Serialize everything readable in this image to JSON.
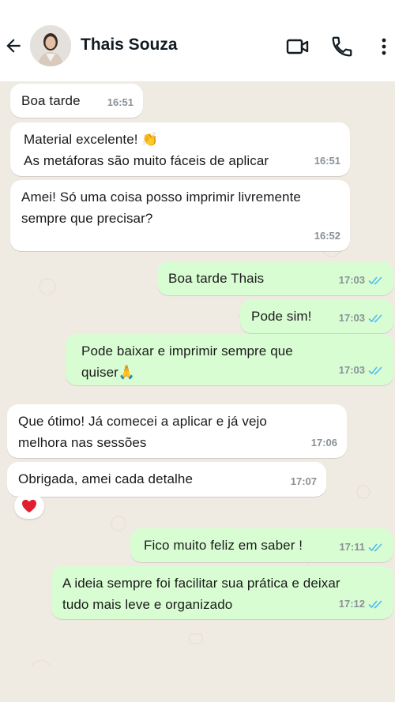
{
  "header": {
    "contact_name": "Thais Souza"
  },
  "messages": [
    {
      "dir": "in",
      "text": "Boa tarde",
      "time": "16:51"
    },
    {
      "dir": "in",
      "text": "Material excelente! 👏\nAs metáforas são muito fáceis de aplicar",
      "time": "16:51"
    },
    {
      "dir": "in",
      "text": "Amei! Só uma coisa posso imprimir livremente\nsempre que precisar?",
      "time": "16:52"
    },
    {
      "dir": "out",
      "text": "Boa tarde Thais",
      "time": "17:03"
    },
    {
      "dir": "out",
      "text": "Pode sim!",
      "time": "17:03"
    },
    {
      "dir": "out",
      "text": "Pode baixar e imprimir sempre que\nquiser🙏",
      "time": "17:03"
    },
    {
      "dir": "in",
      "text": "Que ótimo! Já comecei a aplicar e já vejo\nmelhora nas sessões",
      "time": "17:06"
    },
    {
      "dir": "in",
      "text": "Obrigada, amei cada detalhe",
      "time": "17:07",
      "reaction": "heart"
    },
    {
      "dir": "out",
      "text": "Fico muito feliz em saber !",
      "time": "17:11"
    },
    {
      "dir": "out",
      "text": "A ideia sempre foi facilitar sua prática e deixar\ntudo mais leve e organizado",
      "time": "17:12"
    }
  ],
  "colors": {
    "incoming_bubble": "#ffffff",
    "outgoing_bubble": "#d9fdd3",
    "read_ticks": "#53bdeb",
    "chat_background": "#efeae2"
  }
}
